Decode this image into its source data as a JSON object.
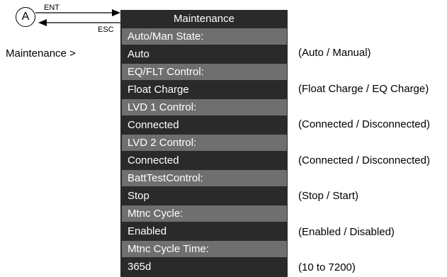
{
  "node": {
    "label": "A",
    "enter_label": "ENT",
    "escape_label": "ESC"
  },
  "breadcrumb": "Maintenance >",
  "panel": {
    "title": "Maintenance",
    "items": [
      {
        "field": "Auto/Man State:",
        "value": "Auto",
        "options": "(Auto / Manual)"
      },
      {
        "field": "EQ/FLT Control:",
        "value": "Float Charge",
        "options": "(Float Charge / EQ Charge)"
      },
      {
        "field": "LVD 1 Control:",
        "value": "Connected",
        "options": "(Connected / Disconnected)"
      },
      {
        "field": "LVD 2 Control:",
        "value": "Connected",
        "options": "(Connected / Disconnected)"
      },
      {
        "field": "BattTestControl:",
        "value": "Stop",
        "options": "(Stop / Start)"
      },
      {
        "field": "Mtnc Cycle:",
        "value": "Enabled",
        "options": "(Enabled / Disabled)"
      },
      {
        "field": "Mtnc Cycle Time:",
        "value": "365d",
        "options": "(10 to 7200)"
      }
    ]
  }
}
